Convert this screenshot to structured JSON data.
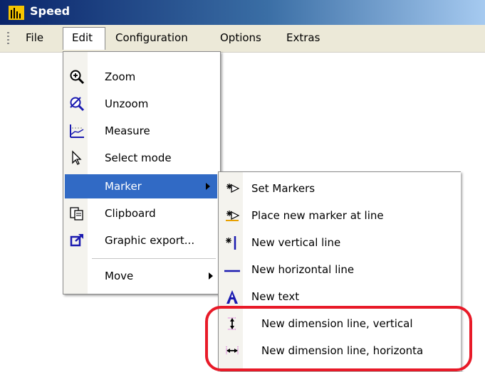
{
  "window": {
    "title": "Speed"
  },
  "menubar": {
    "items": [
      {
        "label": "File"
      },
      {
        "label": "Edit"
      },
      {
        "label": "Configuration"
      },
      {
        "label": "Options"
      },
      {
        "label": "Extras"
      }
    ]
  },
  "edit_menu": {
    "items": [
      {
        "label": "Zoom",
        "icon": "zoom-in-icon"
      },
      {
        "label": "Unzoom",
        "icon": "unzoom-icon"
      },
      {
        "label": "Measure",
        "icon": "measure-icon"
      },
      {
        "label": "Select mode",
        "icon": "cursor-icon"
      },
      {
        "label": "Marker",
        "icon": "",
        "highlighted": true,
        "submenu": true
      },
      {
        "label": "Clipboard",
        "icon": "clipboard-icon"
      },
      {
        "label": "Graphic export...",
        "icon": "export-icon"
      },
      {
        "label": "Move",
        "icon": "",
        "submenu": true
      }
    ]
  },
  "marker_menu": {
    "items": [
      {
        "label": "Set Markers",
        "icon": "set-markers-icon"
      },
      {
        "label": "Place new marker at line",
        "icon": "place-marker-icon"
      },
      {
        "label": "New vertical line",
        "icon": "vertical-line-icon"
      },
      {
        "label": "New horizontal line",
        "icon": "horizontal-line-icon"
      },
      {
        "label": "New text",
        "icon": "text-icon"
      },
      {
        "label": "New dimension line, vertical",
        "icon": "dimension-vertical-icon"
      },
      {
        "label": "New dimension line, horizonta",
        "icon": "dimension-horizontal-icon"
      }
    ]
  },
  "colors": {
    "highlight": "#316ac5",
    "annotation": "#e81a28",
    "titlebar": "#0a246a"
  }
}
